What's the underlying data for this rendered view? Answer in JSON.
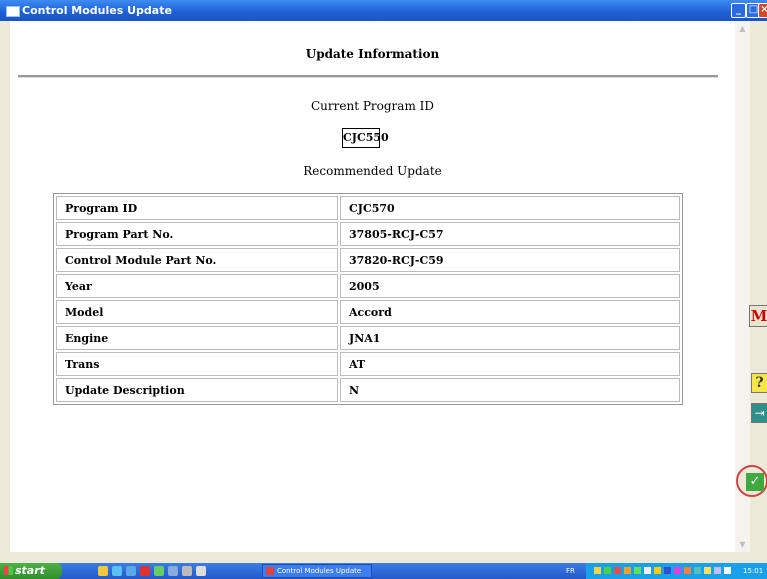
{
  "window": {
    "title": "Control Modules Update"
  },
  "page": {
    "heading": "Update Information",
    "current_label": "Current Program ID",
    "current_value": "CJC550",
    "recommended_label": "Recommended Update"
  },
  "table": {
    "rows": [
      {
        "key": "Program ID",
        "value": "CJC570"
      },
      {
        "key": "Program Part No.",
        "value": "37805-RCJ-C57"
      },
      {
        "key": "Control Module Part No.",
        "value": "37820-RCJ-C59"
      },
      {
        "key": "Year",
        "value": "2005"
      },
      {
        "key": "Model",
        "value": "Accord"
      },
      {
        "key": "Engine",
        "value": "JNA1"
      },
      {
        "key": "Trans",
        "value": "AT"
      },
      {
        "key": "Update Description",
        "value": "N"
      }
    ]
  },
  "side": {
    "m_label": "M",
    "help_label": "?",
    "exit_icon": "exit-icon",
    "ok_label": "✓"
  },
  "taskbar": {
    "start_label": "start",
    "task_label": "Control Modules Update",
    "lang": "FR",
    "clock": "15:01"
  },
  "colors": {
    "titlebar": "#1d5fd3",
    "taskbar": "#2458c8",
    "ok": "#3fa83f"
  }
}
